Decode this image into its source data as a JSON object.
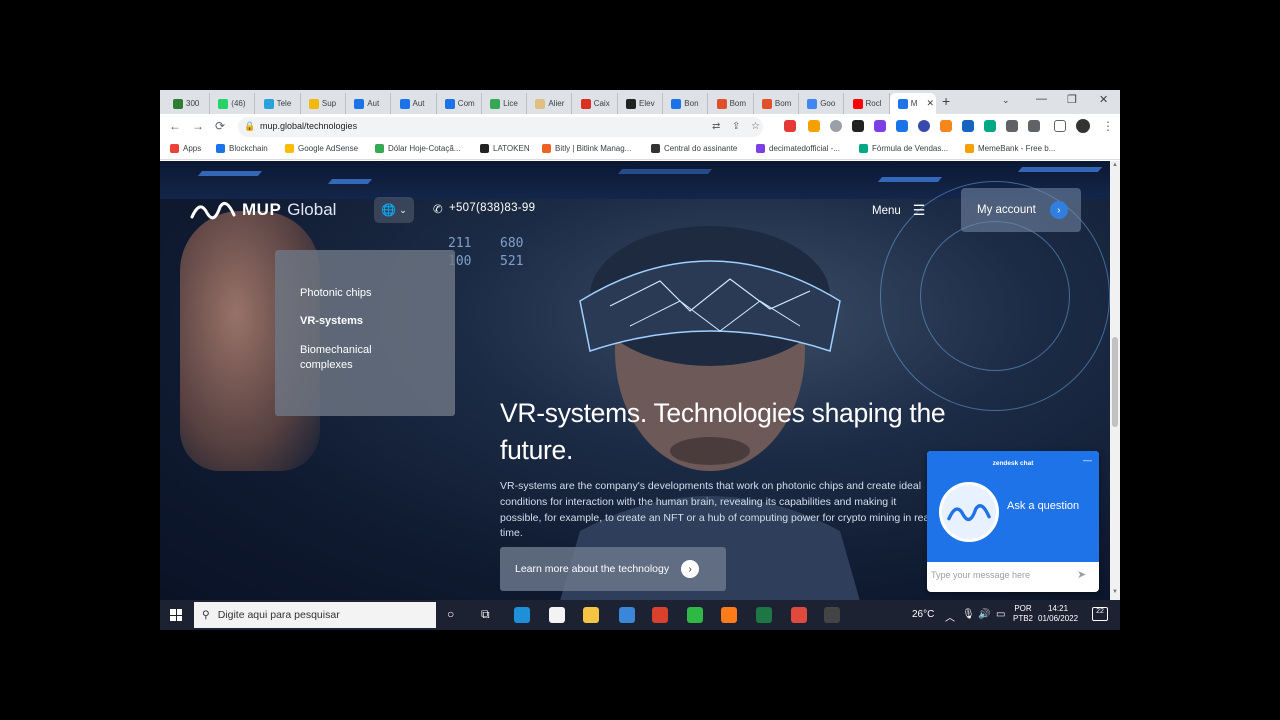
{
  "browser": {
    "tabs": [
      {
        "label": "300",
        "icon_color": "#2e7d32"
      },
      {
        "label": "(46)",
        "icon_color": "#25d366"
      },
      {
        "label": "Tele",
        "icon_color": "#2aa1da"
      },
      {
        "label": "Sup",
        "icon_color": "#f0b90b"
      },
      {
        "label": "Aut",
        "icon_color": "#1a73e8"
      },
      {
        "label": "Aut",
        "icon_color": "#1a73e8"
      },
      {
        "label": "Com",
        "icon_color": "#1a73e8"
      },
      {
        "label": "Lice",
        "icon_color": "#34a853"
      },
      {
        "label": "Alier",
        "icon_color": "#e0c080"
      },
      {
        "label": "Caix",
        "icon_color": "#d93025"
      },
      {
        "label": "Elev",
        "icon_color": "#222222"
      },
      {
        "label": "Bon",
        "icon_color": "#1a73e8"
      },
      {
        "label": "Bom",
        "icon_color": "#e2502b"
      },
      {
        "label": "Bom",
        "icon_color": "#e2502b"
      },
      {
        "label": "Goo",
        "icon_color": "#4285f4"
      },
      {
        "label": "Rocl",
        "icon_color": "#ff0000"
      },
      {
        "label": "M",
        "icon_color": "#1f73e8"
      }
    ],
    "new_tab": "+",
    "tab_search": "⌄",
    "window_buttons": {
      "minimize": "—",
      "restore": "❐",
      "close": "✕"
    },
    "url": "mup.global/technologies",
    "nav": {
      "back": "←",
      "forward": "→",
      "reload": "⟳"
    },
    "bookmarks": [
      {
        "label": "Apps",
        "icon_color": "#ea4335"
      },
      {
        "label": "Blockchain",
        "icon_color": "#1a73e8"
      },
      {
        "label": "Google AdSense",
        "icon_color": "#fbbc04"
      },
      {
        "label": "Dólar Hoje-Cotaçã...",
        "icon_color": "#34a853"
      },
      {
        "label": "LATOKEN",
        "icon_color": "#222222"
      },
      {
        "label": "Bitly | Bitlink Manag...",
        "icon_color": "#ee6123"
      },
      {
        "label": "Central do assinante",
        "icon_color": "#333333"
      },
      {
        "label": "decimatedofficial -...",
        "icon_color": "#7b3fe4"
      },
      {
        "label": "Fórmula de Vendas...",
        "icon_color": "#00a884"
      },
      {
        "label": "MemeBank - Free b...",
        "icon_color": "#f4a100"
      }
    ]
  },
  "site": {
    "logo_strong": "MUP",
    "logo_light": "Global",
    "lang_icon": "🌐",
    "lang_caret": "⌄",
    "phone_icon": "✆",
    "phone": "+507(838)83-99",
    "menu_label": "Menu",
    "menu_icon": "☰",
    "account_label": "My account",
    "arrow": "›",
    "dropdown": [
      "Photonic chips",
      "VR-systems",
      "Biomechanical complexes"
    ],
    "hero_title": "VR-systems. Technologies shaping the future.",
    "hero_desc": "VR-systems are the company's developments that work on photonic chips and create ideal conditions for interaction with the human brain, revealing its capabilities and making it possible, for example, to create an NFT or a hub of computing power for crypto mining in real time.",
    "learn_more": "Learn more about the technology",
    "holo_numbers": [
      "211",
      "680",
      "100",
      "521"
    ]
  },
  "chat": {
    "title": "zendesk chat",
    "minimize": "—",
    "prompt": "Ask a question",
    "placeholder": "Type your message here",
    "send": "➤"
  },
  "taskbar": {
    "search_placeholder": "Digite aqui para pesquisar",
    "weather": "26°C",
    "lang_top": "POR",
    "lang_bottom": "PTB2",
    "time": "14:21",
    "date": "01/06/2022",
    "notifications": "22",
    "apps": [
      {
        "name": "edge",
        "color": "#1e90d8"
      },
      {
        "name": "store",
        "color": "#f3f3f3"
      },
      {
        "name": "explorer",
        "color": "#f4c542"
      },
      {
        "name": "mail-app",
        "color": "#3a86d8"
      },
      {
        "name": "red-app",
        "color": "#d9412e"
      },
      {
        "name": "green-app",
        "color": "#2eb844"
      },
      {
        "name": "firefox",
        "color": "#ff7a1a"
      },
      {
        "name": "excel",
        "color": "#1d7744"
      },
      {
        "name": "chrome",
        "color": "#e04a3c"
      },
      {
        "name": "misc-app",
        "color": "#444444"
      }
    ]
  }
}
